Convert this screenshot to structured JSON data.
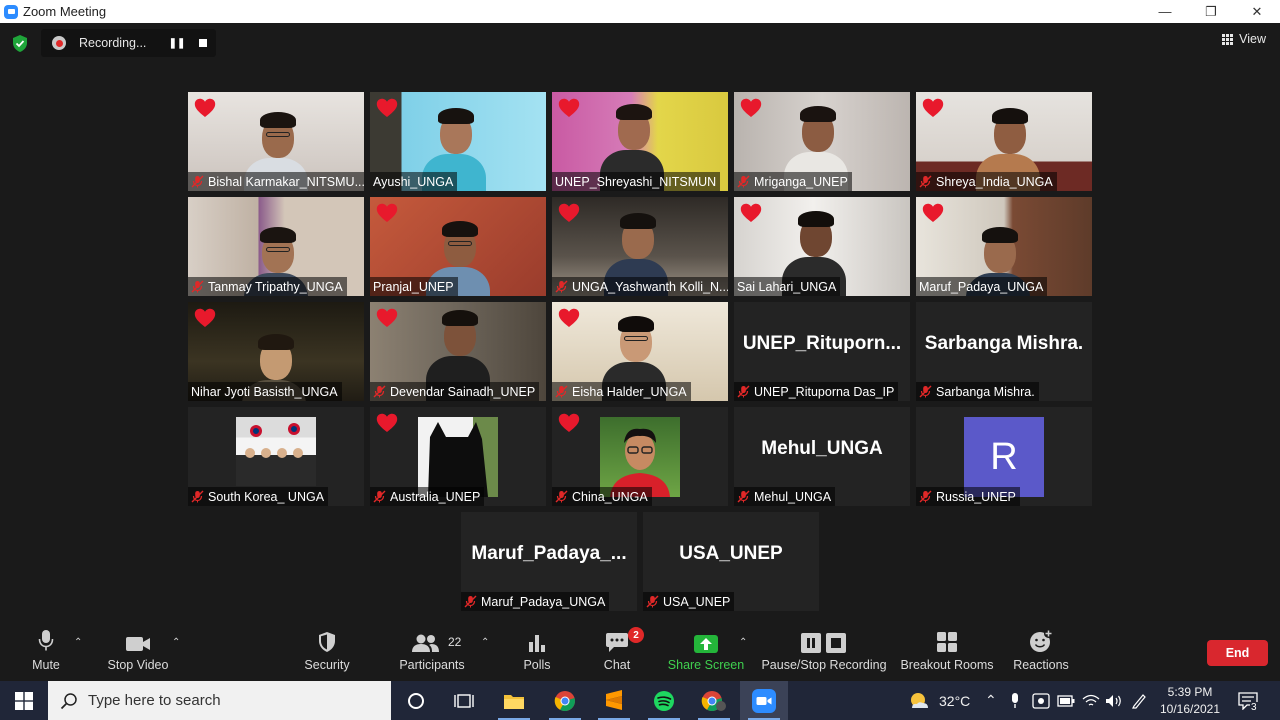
{
  "window": {
    "title": "Zoom Meeting",
    "controls": [
      "minimize",
      "restore",
      "close"
    ]
  },
  "meeting_bar": {
    "security_status_icon": "shield-check-icon",
    "recording_label": "Recording...",
    "view_label": "View"
  },
  "participants": [
    {
      "name": "Bishal Karmakar_NITSMU...",
      "video": true,
      "muted": true,
      "reaction": "heart"
    },
    {
      "name": "Ayushi_UNGA",
      "video": true,
      "muted": false,
      "reaction": "heart",
      "active_speaker": true
    },
    {
      "name": "UNEP_Shreyashi_NITSMUN",
      "video": true,
      "muted": false,
      "reaction": "heart"
    },
    {
      "name": "Mriganga_UNEP",
      "video": true,
      "muted": true,
      "reaction": "heart"
    },
    {
      "name": "Shreya_India_UNGA",
      "video": true,
      "muted": true,
      "reaction": "heart"
    },
    {
      "name": "Tanmay Tripathy_UNGA",
      "video": true,
      "muted": true,
      "reaction": ""
    },
    {
      "name": "Pranjal_UNEP",
      "video": true,
      "muted": false,
      "reaction": "heart"
    },
    {
      "name": "UNGA_Yashwanth Kolli_N...",
      "video": true,
      "muted": true,
      "reaction": "heart"
    },
    {
      "name": "Sai Lahari_UNGA",
      "video": true,
      "muted": false,
      "reaction": "heart"
    },
    {
      "name": "Maruf_Padaya_UNGA",
      "video": true,
      "muted": false,
      "reaction": "heart"
    },
    {
      "name": "Nihar Jyoti Basisth_UNGA",
      "video": true,
      "muted": false,
      "reaction": "heart"
    },
    {
      "name": "Devendar Sainadh_UNEP",
      "video": true,
      "muted": true,
      "reaction": "heart"
    },
    {
      "name": "Eisha Halder_UNGA",
      "video": true,
      "muted": true,
      "reaction": "heart"
    },
    {
      "name": "UNEP_Rituporna Das_IP",
      "display": "UNEP_Rituporn...",
      "video": false,
      "muted": true,
      "reaction": ""
    },
    {
      "name": "Sarbanga Mishra.",
      "display": "Sarbanga Mishra.",
      "video": false,
      "muted": true,
      "reaction": ""
    },
    {
      "name": "South Korea_ UNGA",
      "video": false,
      "picture": "flag-group-photo",
      "muted": true,
      "reaction": ""
    },
    {
      "name": "Australia_UNEP",
      "video": false,
      "picture": "black-cat-photo",
      "muted": true,
      "reaction": "heart"
    },
    {
      "name": "China_UNGA",
      "video": false,
      "picture": "boy-portrait-photo",
      "muted": true,
      "reaction": "heart"
    },
    {
      "name": "Mehul_UNGA",
      "display": "Mehul_UNGA",
      "video": false,
      "muted": true,
      "reaction": ""
    },
    {
      "name": "Russia_UNEP",
      "video": false,
      "avatar_letter": "R",
      "avatar_color": "#5b59c9",
      "muted": true,
      "reaction": ""
    },
    {
      "name": "Maruf_Padaya_UNGA",
      "display": "Maruf_Padaya_...",
      "video": false,
      "muted": true,
      "reaction": ""
    },
    {
      "name": "USA_UNEP",
      "display": "USA_UNEP",
      "video": false,
      "muted": true,
      "reaction": ""
    }
  ],
  "toolbar": {
    "mute_label": "Mute",
    "stop_video_label": "Stop Video",
    "security_label": "Security",
    "participants_label": "Participants",
    "participants_count": "22",
    "polls_label": "Polls",
    "chat_label": "Chat",
    "chat_badge": "2",
    "share_screen_label": "Share Screen",
    "pause_stop_recording_label": "Pause/Stop Recording",
    "breakout_rooms_label": "Breakout Rooms",
    "reactions_label": "Reactions",
    "end_label": "End"
  },
  "taskbar": {
    "search_placeholder": "Type here to search",
    "temperature": "32°C",
    "time": "5:39 PM",
    "date": "10/16/2021",
    "notification_count": "3",
    "apps": [
      "cortana-icon",
      "task-view-icon",
      "file-explorer-icon",
      "chrome-icon",
      "sublime-icon",
      "spotify-icon",
      "chrome-profile-icon",
      "zoom-icon"
    ]
  },
  "colors": {
    "accent_zoom": "#2d8cff",
    "active_speaker_border": "#d4dd5a",
    "end_button": "#d9272e",
    "share_green": "#3fd04f",
    "muted_red": "#e02828"
  }
}
